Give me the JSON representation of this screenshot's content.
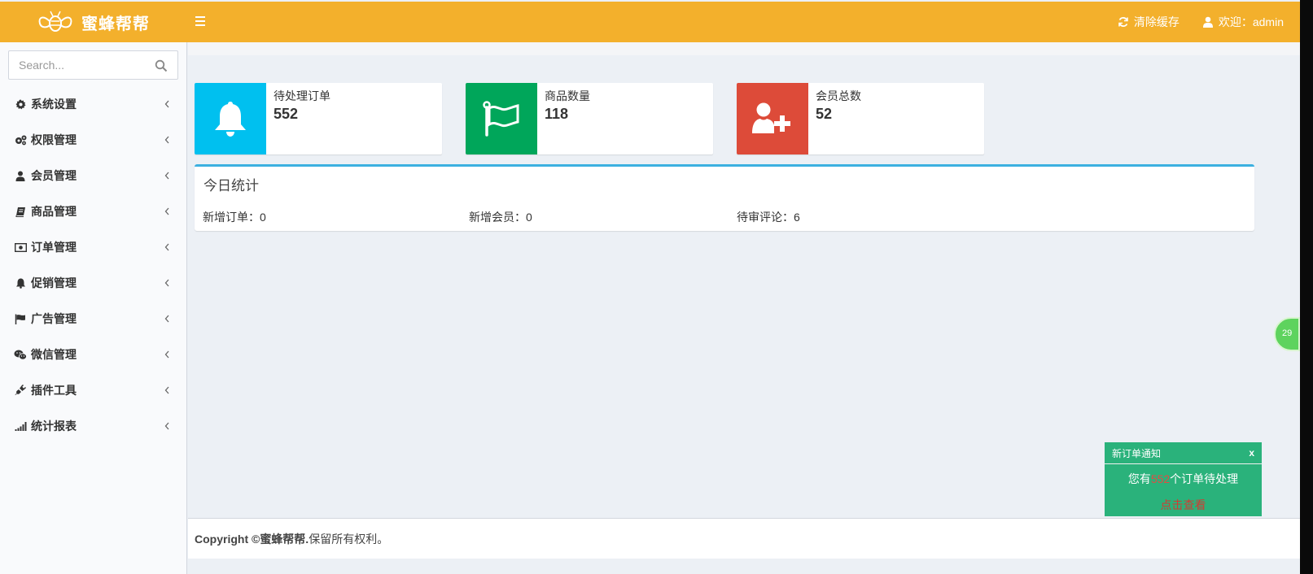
{
  "brand": {
    "name": "蜜蜂帮帮"
  },
  "header": {
    "clear_cache": "清除缓存",
    "welcome": "欢迎：admin"
  },
  "search": {
    "placeholder": "Search..."
  },
  "sidebar": {
    "items": [
      {
        "label": "系统设置",
        "icon": "gear-icon"
      },
      {
        "label": "权限管理",
        "icon": "gears-icon"
      },
      {
        "label": "会员管理",
        "icon": "user-icon"
      },
      {
        "label": "商品管理",
        "icon": "book-icon"
      },
      {
        "label": "订单管理",
        "icon": "money-icon"
      },
      {
        "label": "促销管理",
        "icon": "bell-icon"
      },
      {
        "label": "广告管理",
        "icon": "flag-icon"
      },
      {
        "label": "微信管理",
        "icon": "wechat-icon"
      },
      {
        "label": "插件工具",
        "icon": "plug-icon"
      },
      {
        "label": "统计报表",
        "icon": "signal-icon"
      }
    ]
  },
  "info_boxes": [
    {
      "label": "待处理订单",
      "value": "552",
      "color": "#00c0ef",
      "icon": "bell-icon"
    },
    {
      "label": "商品数量",
      "value": "118",
      "color": "#00a65a",
      "icon": "flag-icon"
    },
    {
      "label": "会员总数",
      "value": "52",
      "color": "#dd4b39",
      "icon": "user-plus-icon"
    }
  ],
  "today": {
    "title": "今日统计",
    "new_orders": "新增订单：0",
    "new_members": "新增会员：0",
    "pending_reviews": "待审评论：6"
  },
  "bubble": {
    "text": "29"
  },
  "notify": {
    "title": "新订单通知",
    "close": "x",
    "msg_prefix": "您有",
    "msg_count": "552",
    "msg_suffix": "个订单待处理",
    "link": "点击查看"
  },
  "footer": {
    "prefix": "Copyright © ",
    "brand": "蜜蜂帮帮.",
    "suffix": "保留所有权利。"
  },
  "colors": {
    "header": "#f3b02c",
    "accent_border": "#3cb0e0"
  }
}
